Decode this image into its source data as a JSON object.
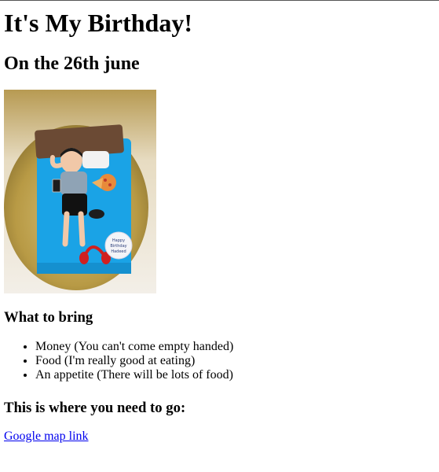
{
  "page": {
    "title": "It's My Birthday!",
    "date_heading": "On the 26th june",
    "bring_heading": "What to bring",
    "bring_items": [
      "Money (You can't come empty handed)",
      "Food (I'm really good at eating)",
      "An appetite (There will be lots of food)"
    ],
    "where_heading": "This is where you need to go:",
    "map_link_label": "Google map link"
  },
  "image": {
    "subject": "birthday-cake-photo",
    "cake_topper_text": "Happy Birthday Hadeed"
  },
  "colors": {
    "link": "#0000ee",
    "cake_blue": "#1aa3e6"
  }
}
